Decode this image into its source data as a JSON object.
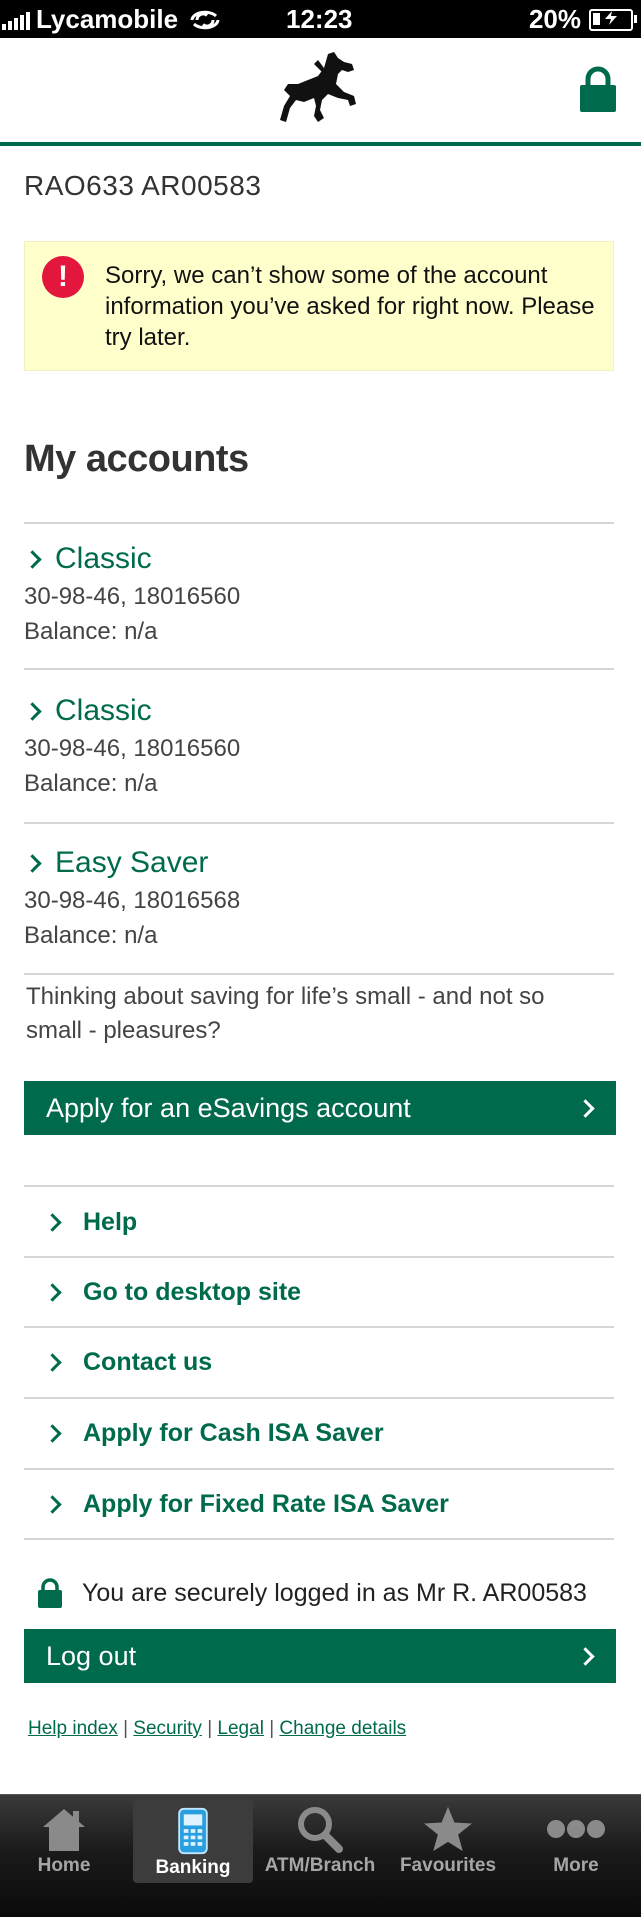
{
  "status_bar": {
    "carrier": "Lycamobile",
    "time": "12:23",
    "battery_percent": "20%",
    "battery_level": 0.2
  },
  "header": {
    "logo_icon": "black-horse-logo-icon",
    "lock_icon": "padlock-icon",
    "brand_color": "#006a4d"
  },
  "customer_ref": "RAO633 AR00583",
  "alert": {
    "icon": "exclamation-icon",
    "color": "#e3173e",
    "message": "Sorry, we can’t show some of the account information you’ve asked for right now. Please try later."
  },
  "accounts_section": {
    "title": "My accounts",
    "accounts": [
      {
        "name": "Classic",
        "sort_account": "30-98-46, 18016560",
        "balance": "Balance: n/a"
      },
      {
        "name": "Classic",
        "sort_account": "30-98-46, 18016560",
        "balance": "Balance: n/a"
      },
      {
        "name": "Easy Saver",
        "sort_account": "30-98-46, 18016568",
        "balance": "Balance: n/a"
      }
    ]
  },
  "promo": {
    "text": "Thinking about saving for life’s small - and not so small - pleasures?",
    "button_label": "Apply for an eSavings account"
  },
  "links": [
    {
      "label": "Help"
    },
    {
      "label": "Go to desktop site"
    },
    {
      "label": "Contact us"
    },
    {
      "label": "Apply for Cash ISA Saver"
    },
    {
      "label": "Apply for Fixed Rate ISA Saver"
    }
  ],
  "session": {
    "secure_text": "You are securely logged in as Mr R. AR00583",
    "logout_label": "Log out"
  },
  "footer_links": {
    "help_index": "Help index",
    "security": "Security",
    "legal": "Legal",
    "change_details": "Change details",
    "separator": "|"
  },
  "tabbar": {
    "active": "Banking",
    "tabs": [
      {
        "label": "Home",
        "icon": "house-icon"
      },
      {
        "label": "Banking",
        "icon": "phone-keypad-icon"
      },
      {
        "label": "ATM/Branch",
        "icon": "magnifier-icon"
      },
      {
        "label": "Favourites",
        "icon": "star-icon"
      },
      {
        "label": "More",
        "icon": "ellipsis-icon"
      }
    ]
  }
}
